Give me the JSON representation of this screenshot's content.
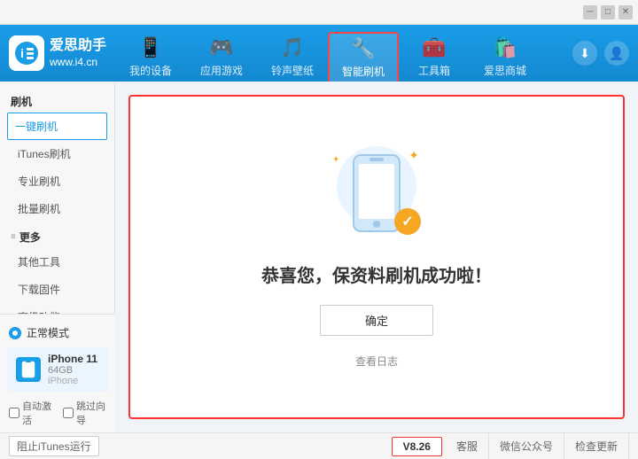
{
  "titleBar": {
    "controls": [
      "minimize",
      "maximize",
      "close"
    ]
  },
  "header": {
    "logoText": "爱思助手",
    "logoSub": "www.i4.cn",
    "navTabs": [
      {
        "id": "my-device",
        "label": "我的设备",
        "icon": "📱"
      },
      {
        "id": "apps-games",
        "label": "应用游戏",
        "icon": "🎮"
      },
      {
        "id": "ringtones",
        "label": "铃声壁纸",
        "icon": "🎵"
      },
      {
        "id": "smart-flash",
        "label": "智能刷机",
        "icon": "🔧",
        "active": true
      },
      {
        "id": "toolbox",
        "label": "工具箱",
        "icon": "🧰"
      },
      {
        "id": "store",
        "label": "爱思商城",
        "icon": "🛍️"
      }
    ]
  },
  "sidebar": {
    "flashSection": "刷机",
    "items": [
      {
        "id": "one-click-flash",
        "label": "一键刷机",
        "active": true
      },
      {
        "id": "itunes-flash",
        "label": "iTunes刷机"
      },
      {
        "id": "pro-flash",
        "label": "专业刷机"
      },
      {
        "id": "batch-flash",
        "label": "批量刷机"
      }
    ],
    "moreSection": "更多",
    "moreItems": [
      {
        "id": "other-tools",
        "label": "其他工具"
      },
      {
        "id": "download-firmware",
        "label": "下载固件"
      },
      {
        "id": "advanced",
        "label": "高级功能"
      }
    ],
    "deviceMode": "正常模式",
    "device": {
      "name": "iPhone 11",
      "storage": "64GB",
      "type": "iPhone"
    },
    "autoActivate": "自动激活",
    "guideMode": "跳过向导"
  },
  "content": {
    "successTitle": "恭喜您，保资料刷机成功啦！",
    "confirmBtn": "确定",
    "viewHistory": "查看日志"
  },
  "footer": {
    "stopItunes": "阻止iTunes运行",
    "version": "V8.26",
    "support": "客服",
    "wechat": "微信公众号",
    "checkUpdate": "检查更新"
  }
}
